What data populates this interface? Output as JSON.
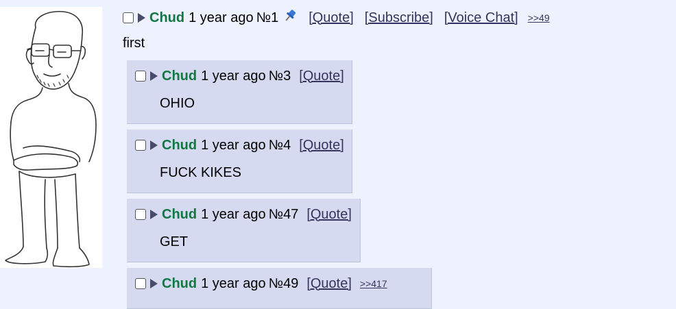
{
  "op": {
    "name": "Chud",
    "date": "1 year ago",
    "number": "№1",
    "quote_label": "[Quote]",
    "subscribe_label": "[Subscribe]",
    "voice_chat_label": "[Voice Chat]",
    "backlinks": ">>49",
    "body": "first"
  },
  "replies": [
    {
      "name": "Chud",
      "date": "1 year ago",
      "number": "№3",
      "quote_label": "[Quote]",
      "body": "OHIO"
    },
    {
      "name": "Chud",
      "date": "1 year ago",
      "number": "№4",
      "quote_label": "[Quote]",
      "body": "FUCK KIKES"
    },
    {
      "name": "Chud",
      "date": "1 year ago",
      "number": "№47",
      "quote_label": "[Quote]",
      "body": "GET"
    },
    {
      "name": "Chud",
      "date": "1 year ago",
      "number": "№49",
      "quote_label": "[Quote]",
      "backlinks": ">>417",
      "body": ""
    }
  ],
  "colors": {
    "page_bg": "#eef2ff",
    "reply_bg": "#d6daf0",
    "name": "#117743",
    "link": "#34345c"
  },
  "icons": {
    "select": "checkbox-icon",
    "expand": "triangle-right-icon",
    "pin": "pushpin-icon"
  }
}
